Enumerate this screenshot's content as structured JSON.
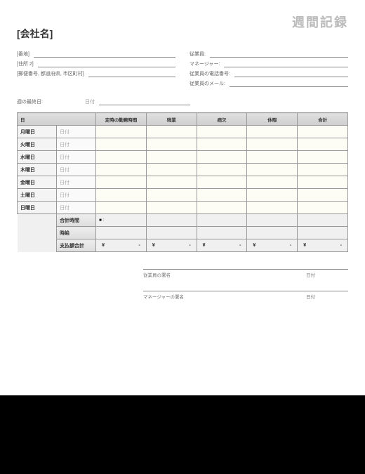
{
  "title": "週間記録",
  "company": "[会社名]",
  "address": {
    "line1": "[番地]",
    "line2": "[住所 2]",
    "line3": "[郵便番号, 都道府県, 市区町村]"
  },
  "employee_fields": {
    "emp": "従業員:",
    "mgr": "マネージャー:",
    "phone": "従業員の電話番号:",
    "email": "従業員のメール:"
  },
  "weekend": {
    "label": "週の最終日:",
    "date_label": "日付"
  },
  "columns": {
    "day": "日",
    "regular": "定時の勤務時間",
    "overtime": "残業",
    "sick": "病欠",
    "vacation": "休暇",
    "total": "合計"
  },
  "days": [
    "月曜日",
    "火曜日",
    "水曜日",
    "木曜日",
    "金曜日",
    "土曜日",
    "日曜日"
  ],
  "date_ph": "日付",
  "summary": {
    "total_hours": "合計時間",
    "rate": "時給",
    "total_pay": "支払額合計"
  },
  "currency": "¥",
  "dash": "-",
  "tag_mark": "■ :",
  "signatures": {
    "emp": "従業員の署名",
    "mgr": "マネージャーの署名",
    "date": "日付"
  },
  "chart_data": {
    "type": "table",
    "title": "週間記録",
    "columns": [
      "日",
      "定時の勤務時間",
      "残業",
      "病欠",
      "休暇",
      "合計"
    ],
    "rows": [
      {
        "day": "月曜日",
        "regular": null,
        "overtime": null,
        "sick": null,
        "vacation": null,
        "total": null
      },
      {
        "day": "火曜日",
        "regular": null,
        "overtime": null,
        "sick": null,
        "vacation": null,
        "total": null
      },
      {
        "day": "水曜日",
        "regular": null,
        "overtime": null,
        "sick": null,
        "vacation": null,
        "total": null
      },
      {
        "day": "木曜日",
        "regular": null,
        "overtime": null,
        "sick": null,
        "vacation": null,
        "total": null
      },
      {
        "day": "金曜日",
        "regular": null,
        "overtime": null,
        "sick": null,
        "vacation": null,
        "total": null
      },
      {
        "day": "土曜日",
        "regular": null,
        "overtime": null,
        "sick": null,
        "vacation": null,
        "total": null
      },
      {
        "day": "日曜日",
        "regular": null,
        "overtime": null,
        "sick": null,
        "vacation": null,
        "total": null
      }
    ],
    "totals": {
      "total_hours": null,
      "rate": null,
      "total_pay": {
        "regular": "¥ -",
        "overtime": "¥ -",
        "sick": "¥ -",
        "vacation": "¥ -",
        "total": "¥ -"
      }
    }
  }
}
